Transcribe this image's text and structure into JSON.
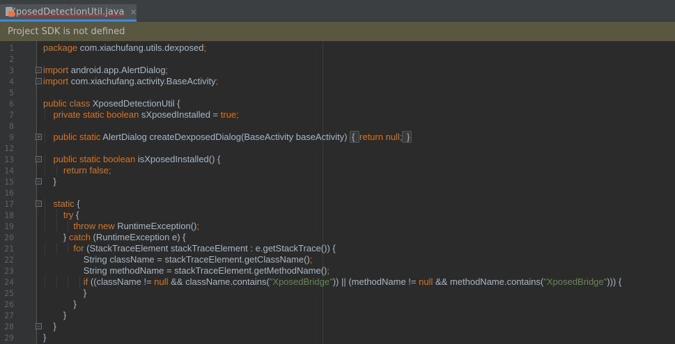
{
  "tab": {
    "filename": "XposedDetectionUtil.java",
    "close": "×"
  },
  "banner": {
    "text": "Project SDK is not defined"
  },
  "colors": {
    "keyword": "#cc7832",
    "plain": "#a9b7c6",
    "string": "#6a8759",
    "banner_bg": "#59573f",
    "editor_bg": "#2b2b2b"
  },
  "lines": [
    {
      "n": "1",
      "fold": "",
      "parts": [
        [
          "kw",
          "package"
        ],
        [
          "p",
          " com.xiachufang.utils.dexposed"
        ],
        [
          "kw",
          ";"
        ]
      ]
    },
    {
      "n": "2",
      "fold": "",
      "parts": []
    },
    {
      "n": "3",
      "fold": "-",
      "parts": [
        [
          "kw",
          "import"
        ],
        [
          "p",
          " android.app.AlertDialog"
        ],
        [
          "kw",
          ";"
        ]
      ]
    },
    {
      "n": "4",
      "fold": "-",
      "parts": [
        [
          "kw",
          "import"
        ],
        [
          "p",
          " com.xiachufang.activity.BaseActivity"
        ],
        [
          "kw",
          ";"
        ]
      ]
    },
    {
      "n": "5",
      "fold": "",
      "parts": []
    },
    {
      "n": "6",
      "fold": "",
      "parts": [
        [
          "kw",
          "public class"
        ],
        [
          "p",
          " XposedDetectionUtil {"
        ]
      ]
    },
    {
      "n": "7",
      "fold": "",
      "parts": [
        [
          "p",
          "    "
        ],
        [
          "kw",
          "private static boolean"
        ],
        [
          "p",
          " sXposedInstalled = "
        ],
        [
          "kw",
          "true;"
        ]
      ]
    },
    {
      "n": "8",
      "fold": "",
      "parts": []
    },
    {
      "n": "9",
      "fold": "+",
      "parts": [
        [
          "p",
          "    "
        ],
        [
          "kw",
          "public static"
        ],
        [
          "p",
          " AlertDialog createDexposedDialog(BaseActivity baseActivity) "
        ],
        [
          "c",
          "{ "
        ],
        [
          "kw",
          "return null;"
        ],
        [
          "c",
          " }"
        ]
      ]
    },
    {
      "n": "12",
      "fold": "",
      "parts": []
    },
    {
      "n": "13",
      "fold": "-",
      "parts": [
        [
          "p",
          "    "
        ],
        [
          "kw",
          "public static boolean"
        ],
        [
          "p",
          " isXposedInstalled() {"
        ]
      ]
    },
    {
      "n": "14",
      "fold": "",
      "parts": [
        [
          "p",
          "        "
        ],
        [
          "kw",
          "return false;"
        ]
      ]
    },
    {
      "n": "15",
      "fold": "-",
      "parts": [
        [
          "p",
          "    }"
        ]
      ]
    },
    {
      "n": "16",
      "fold": "",
      "parts": []
    },
    {
      "n": "17",
      "fold": "-",
      "parts": [
        [
          "p",
          "    "
        ],
        [
          "kw",
          "static"
        ],
        [
          "p",
          " {"
        ]
      ]
    },
    {
      "n": "18",
      "fold": "",
      "parts": [
        [
          "p",
          "        "
        ],
        [
          "kw",
          "try"
        ],
        [
          "p",
          " {"
        ]
      ]
    },
    {
      "n": "19",
      "fold": "",
      "parts": [
        [
          "p",
          "            "
        ],
        [
          "kw",
          "throw new"
        ],
        [
          "p",
          " RuntimeException()"
        ],
        [
          "kw",
          ";"
        ]
      ]
    },
    {
      "n": "20",
      "fold": "",
      "parts": [
        [
          "p",
          "        } "
        ],
        [
          "kw",
          "catch"
        ],
        [
          "p",
          " (RuntimeException e) {"
        ]
      ]
    },
    {
      "n": "21",
      "fold": "",
      "parts": [
        [
          "p",
          "            "
        ],
        [
          "kw",
          "for"
        ],
        [
          "p",
          " (StackTraceElement stackTraceElement : e.getStackTrace()) {"
        ]
      ]
    },
    {
      "n": "22",
      "fold": "",
      "parts": [
        [
          "p",
          "                String className = stackTraceElement.getClassName()"
        ],
        [
          "kw",
          ";"
        ]
      ]
    },
    {
      "n": "23",
      "fold": "",
      "parts": [
        [
          "p",
          "                String methodName = stackTraceElement.getMethodName()"
        ],
        [
          "kw",
          ";"
        ]
      ]
    },
    {
      "n": "24",
      "fold": "",
      "parts": [
        [
          "p",
          "                "
        ],
        [
          "kw",
          "if"
        ],
        [
          "p",
          " ((className != "
        ],
        [
          "kw",
          "null"
        ],
        [
          "p",
          " && className.contains("
        ],
        [
          "str",
          "\"XposedBridge\""
        ],
        [
          "p",
          ")) || (methodName != "
        ],
        [
          "kw",
          "null"
        ],
        [
          "p",
          " && methodName.contains("
        ],
        [
          "str",
          "\"XposedBridge\""
        ],
        [
          "p",
          "))) {"
        ]
      ]
    },
    {
      "n": "25",
      "fold": "",
      "parts": [
        [
          "p",
          "                }"
        ]
      ]
    },
    {
      "n": "26",
      "fold": "",
      "parts": [
        [
          "p",
          "            }"
        ]
      ]
    },
    {
      "n": "27",
      "fold": "",
      "parts": [
        [
          "p",
          "        }"
        ]
      ]
    },
    {
      "n": "28",
      "fold": "-",
      "parts": [
        [
          "p",
          "    }"
        ]
      ]
    },
    {
      "n": "29",
      "fold": "",
      "parts": [
        [
          "p",
          "}"
        ]
      ]
    }
  ]
}
